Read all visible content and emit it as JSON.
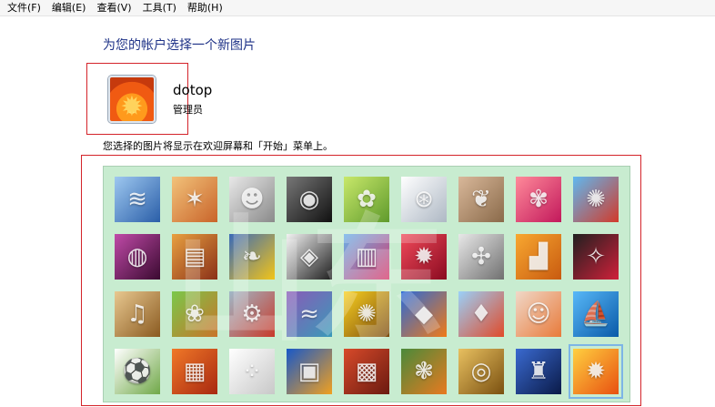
{
  "menu": [
    "文件(F)",
    "编辑(E)",
    "查看(V)",
    "工具(T)",
    "帮助(H)"
  ],
  "heading": "为您的帐户选择一个新图片",
  "user": {
    "name": "dotop",
    "role": "管理员"
  },
  "description": "您选择的图片将显示在欢迎屏幕和「开始」菜单上。",
  "pictures": [
    [
      {
        "name": "roller-coaster",
        "colors": [
          "#9ec8f0",
          "#2a5ea8"
        ],
        "glyph": "≋"
      },
      {
        "name": "starfish",
        "colors": [
          "#f2c27a",
          "#c9642a"
        ],
        "glyph": "✶"
      },
      {
        "name": "robot",
        "colors": [
          "#e8e8e8",
          "#8a8a8a"
        ],
        "glyph": "☻"
      },
      {
        "name": "turntable",
        "colors": [
          "#777777",
          "#111111"
        ],
        "glyph": "◉"
      },
      {
        "name": "lucky-cat",
        "colors": [
          "#c8e86a",
          "#5f9a2c"
        ],
        "glyph": "✿"
      },
      {
        "name": "gyroscope",
        "colors": [
          "#ffffff",
          "#aeb8c4"
        ],
        "glyph": "⊛"
      },
      {
        "name": "kitten",
        "colors": [
          "#d9b89a",
          "#8a6a4a"
        ],
        "glyph": "❦"
      },
      {
        "name": "pink-flower",
        "colors": [
          "#ff8a9a",
          "#c2185b"
        ],
        "glyph": "✾"
      },
      {
        "name": "pinwheel",
        "colors": [
          "#5fb8f0",
          "#d23a2a"
        ],
        "glyph": "✺"
      }
    ],
    [
      {
        "name": "striped-ball",
        "colors": [
          "#c04aa8",
          "#3a0a30"
        ],
        "glyph": "◍"
      },
      {
        "name": "fabric",
        "colors": [
          "#e8a040",
          "#8a3018"
        ],
        "glyph": "▤"
      },
      {
        "name": "yellow-leaf",
        "colors": [
          "#3a6ab8",
          "#f2c418"
        ],
        "glyph": "❧"
      },
      {
        "name": "border-collie",
        "colors": [
          "#f2f2f2",
          "#202020"
        ],
        "glyph": "◈"
      },
      {
        "name": "crayons",
        "colors": [
          "#6ab0e8",
          "#d83a6a"
        ],
        "glyph": "▥"
      },
      {
        "name": "red-leaf",
        "colors": [
          "#f04a5a",
          "#8a0a20"
        ],
        "glyph": "✹"
      },
      {
        "name": "jacks",
        "colors": [
          "#e8e8e8",
          "#707070"
        ],
        "glyph": "✣"
      },
      {
        "name": "orange-stairs",
        "colors": [
          "#f8a830",
          "#c85a10"
        ],
        "glyph": "▟"
      },
      {
        "name": "paper-crane",
        "colors": [
          "#202020",
          "#d0203a"
        ],
        "glyph": "✧"
      }
    ],
    [
      {
        "name": "guitar",
        "colors": [
          "#e8c890",
          "#8a5a20"
        ],
        "glyph": "♫"
      },
      {
        "name": "pomeranian",
        "colors": [
          "#7ac84a",
          "#c8742a"
        ],
        "glyph": "❀"
      },
      {
        "name": "toy-robot",
        "colors": [
          "#a0b8c8",
          "#c83a2a"
        ],
        "glyph": "⚙"
      },
      {
        "name": "scarves",
        "colors": [
          "#8a5ab8",
          "#3a9ab8"
        ],
        "glyph": "≈"
      },
      {
        "name": "sunflower",
        "colors": [
          "#f8d020",
          "#7a4a10"
        ],
        "glyph": "✺"
      },
      {
        "name": "clownfish",
        "colors": [
          "#2a6ad8",
          "#f07a18"
        ],
        "glyph": "◆"
      },
      {
        "name": "hot-air-balloon",
        "colors": [
          "#9ad0f8",
          "#e04a2a"
        ],
        "glyph": "♦"
      },
      {
        "name": "doll",
        "colors": [
          "#f0d8c8",
          "#e87a3a"
        ],
        "glyph": "☺"
      },
      {
        "name": "sailboat",
        "colors": [
          "#58b8f8",
          "#0a5aa8"
        ],
        "glyph": "⛵"
      }
    ],
    [
      {
        "name": "soccer-ball",
        "colors": [
          "#ffffff",
          "#70a848"
        ],
        "glyph": "⚽"
      },
      {
        "name": "orange-fabric",
        "colors": [
          "#f07828",
          "#a82810"
        ],
        "glyph": "▦"
      },
      {
        "name": "marbles",
        "colors": [
          "#ffffff",
          "#c8c8c8"
        ],
        "glyph": "⁘"
      },
      {
        "name": "window",
        "colors": [
          "#1858c8",
          "#f0a020"
        ],
        "glyph": "▣"
      },
      {
        "name": "rug",
        "colors": [
          "#d84a2a",
          "#6a1a10"
        ],
        "glyph": "▩"
      },
      {
        "name": "butterfly",
        "colors": [
          "#4a8a3a",
          "#e87a20"
        ],
        "glyph": "❃"
      },
      {
        "name": "wicker",
        "colors": [
          "#e8c060",
          "#7a5010"
        ],
        "glyph": "◎"
      },
      {
        "name": "lighthouse",
        "colors": [
          "#3a6ad0",
          "#0a1a48"
        ],
        "glyph": "♜"
      },
      {
        "name": "orange-flower",
        "colors": [
          "#ffd040",
          "#e85010"
        ],
        "glyph": "✹"
      }
    ]
  ],
  "selected": "orange-flower"
}
